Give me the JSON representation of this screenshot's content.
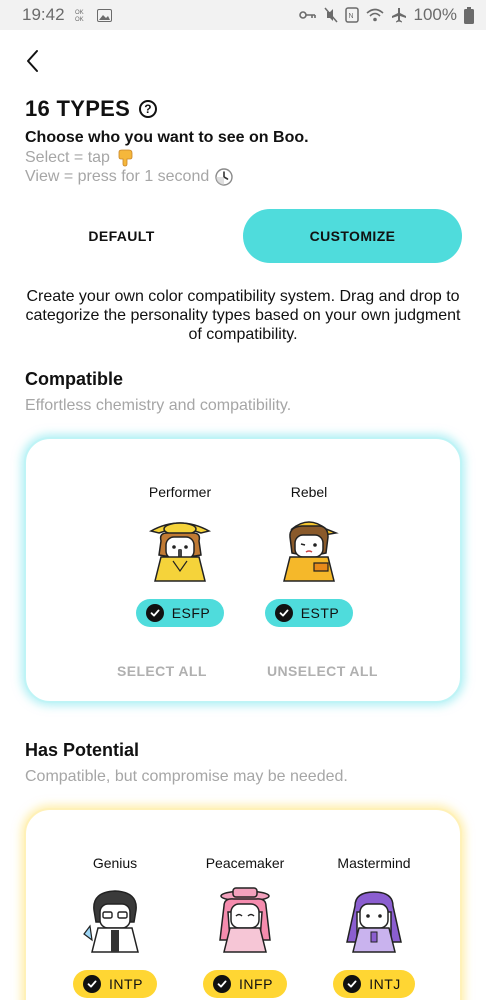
{
  "status_bar": {
    "time": "19:42",
    "battery": "100%"
  },
  "header": {
    "title": "16 TYPES",
    "subtitle": "Choose who you want to see on Boo.",
    "hint_select": "Select = tap",
    "hint_view": "View = press for 1 second"
  },
  "mode_tabs": [
    {
      "label": "DEFAULT",
      "active": false
    },
    {
      "label": "CUSTOMIZE",
      "active": true
    }
  ],
  "description": "Create your own color compatibility system. Drag and drop to categorize the personality types based on your own judgment of compatibility.",
  "sections": [
    {
      "title": "Compatible",
      "subtitle": "Effortless chemistry and compatibility.",
      "accent": "#4fdcdc",
      "types": [
        {
          "name": "Performer",
          "code": "ESFP",
          "icon": "performer-avatar"
        },
        {
          "name": "Rebel",
          "code": "ESTP",
          "icon": "rebel-avatar"
        }
      ],
      "select_all": "SELECT ALL",
      "unselect_all": "UNSELECT ALL"
    },
    {
      "title": "Has Potential",
      "subtitle": "Compatible, but compromise may be needed.",
      "accent": "#ffd633",
      "types": [
        {
          "name": "Genius",
          "code": "INTP",
          "icon": "genius-avatar"
        },
        {
          "name": "Peacemaker",
          "code": "INFP",
          "icon": "peacemaker-avatar"
        },
        {
          "name": "Mastermind",
          "code": "INTJ",
          "icon": "mastermind-avatar"
        }
      ]
    }
  ]
}
